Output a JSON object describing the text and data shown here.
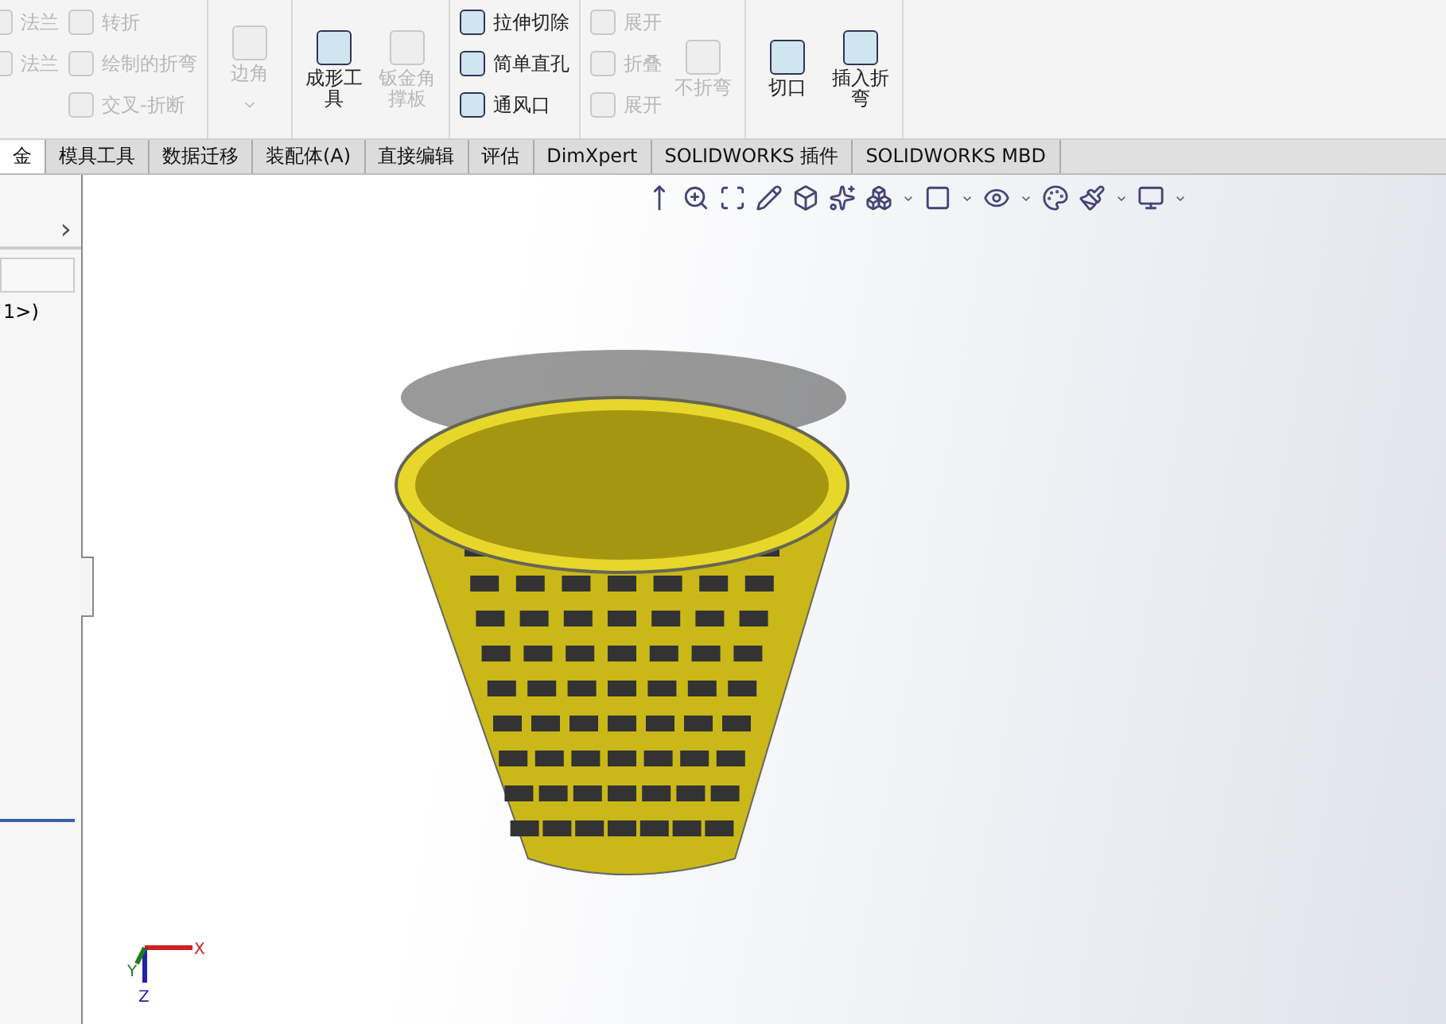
{
  "ribbon": {
    "groups": [
      {
        "columns": [
          [
            {
              "kind": "small",
              "label": "法兰",
              "disabled": true
            },
            {
              "kind": "small",
              "label": "法兰",
              "disabled": true
            }
          ],
          [
            {
              "kind": "small",
              "label": "转折",
              "disabled": true
            },
            {
              "kind": "small",
              "label": "绘制的折弯",
              "disabled": true
            },
            {
              "kind": "small",
              "label": "交叉-折断",
              "disabled": true
            }
          ]
        ]
      },
      {
        "columns": [
          [
            {
              "kind": "big",
              "label": "边角",
              "disabled": true,
              "dropdown": true
            }
          ]
        ]
      },
      {
        "columns": [
          [
            {
              "kind": "big",
              "label": "成形工具",
              "disabled": false
            }
          ],
          [
            {
              "kind": "big",
              "label": "钣金角撑板",
              "disabled": true
            }
          ]
        ]
      },
      {
        "columns": [
          [
            {
              "kind": "small",
              "label": "拉伸切除",
              "disabled": false
            },
            {
              "kind": "small",
              "label": "简单直孔",
              "disabled": false
            },
            {
              "kind": "small",
              "label": "通风口",
              "disabled": false
            }
          ]
        ]
      },
      {
        "columns": [
          [
            {
              "kind": "small",
              "label": "展开",
              "disabled": true
            },
            {
              "kind": "small",
              "label": "折叠",
              "disabled": true
            },
            {
              "kind": "small",
              "label": "展开",
              "disabled": true
            }
          ],
          [
            {
              "kind": "big",
              "label": "不折弯",
              "disabled": true
            }
          ]
        ]
      },
      {
        "columns": [
          [
            {
              "kind": "big",
              "label": "切口",
              "disabled": false
            }
          ],
          [
            {
              "kind": "big",
              "label": "插入折弯",
              "disabled": false
            }
          ]
        ]
      }
    ]
  },
  "tabs": [
    {
      "label": "金",
      "selected": true
    },
    {
      "label": "模具工具",
      "selected": false
    },
    {
      "label": "数据迁移",
      "selected": false
    },
    {
      "label": "装配体(A)",
      "selected": false
    },
    {
      "label": "直接编辑",
      "selected": false
    },
    {
      "label": "评估",
      "selected": false
    },
    {
      "label": "DimXpert",
      "selected": false
    },
    {
      "label": "SOLIDWORKS 插件",
      "selected": false
    },
    {
      "label": "SOLIDWORKS MBD",
      "selected": false
    }
  ],
  "side_panel": {
    "chevron": "›",
    "tree_item": "1>)"
  },
  "triad": {
    "x": "X",
    "y": "Y",
    "z": "Z"
  }
}
